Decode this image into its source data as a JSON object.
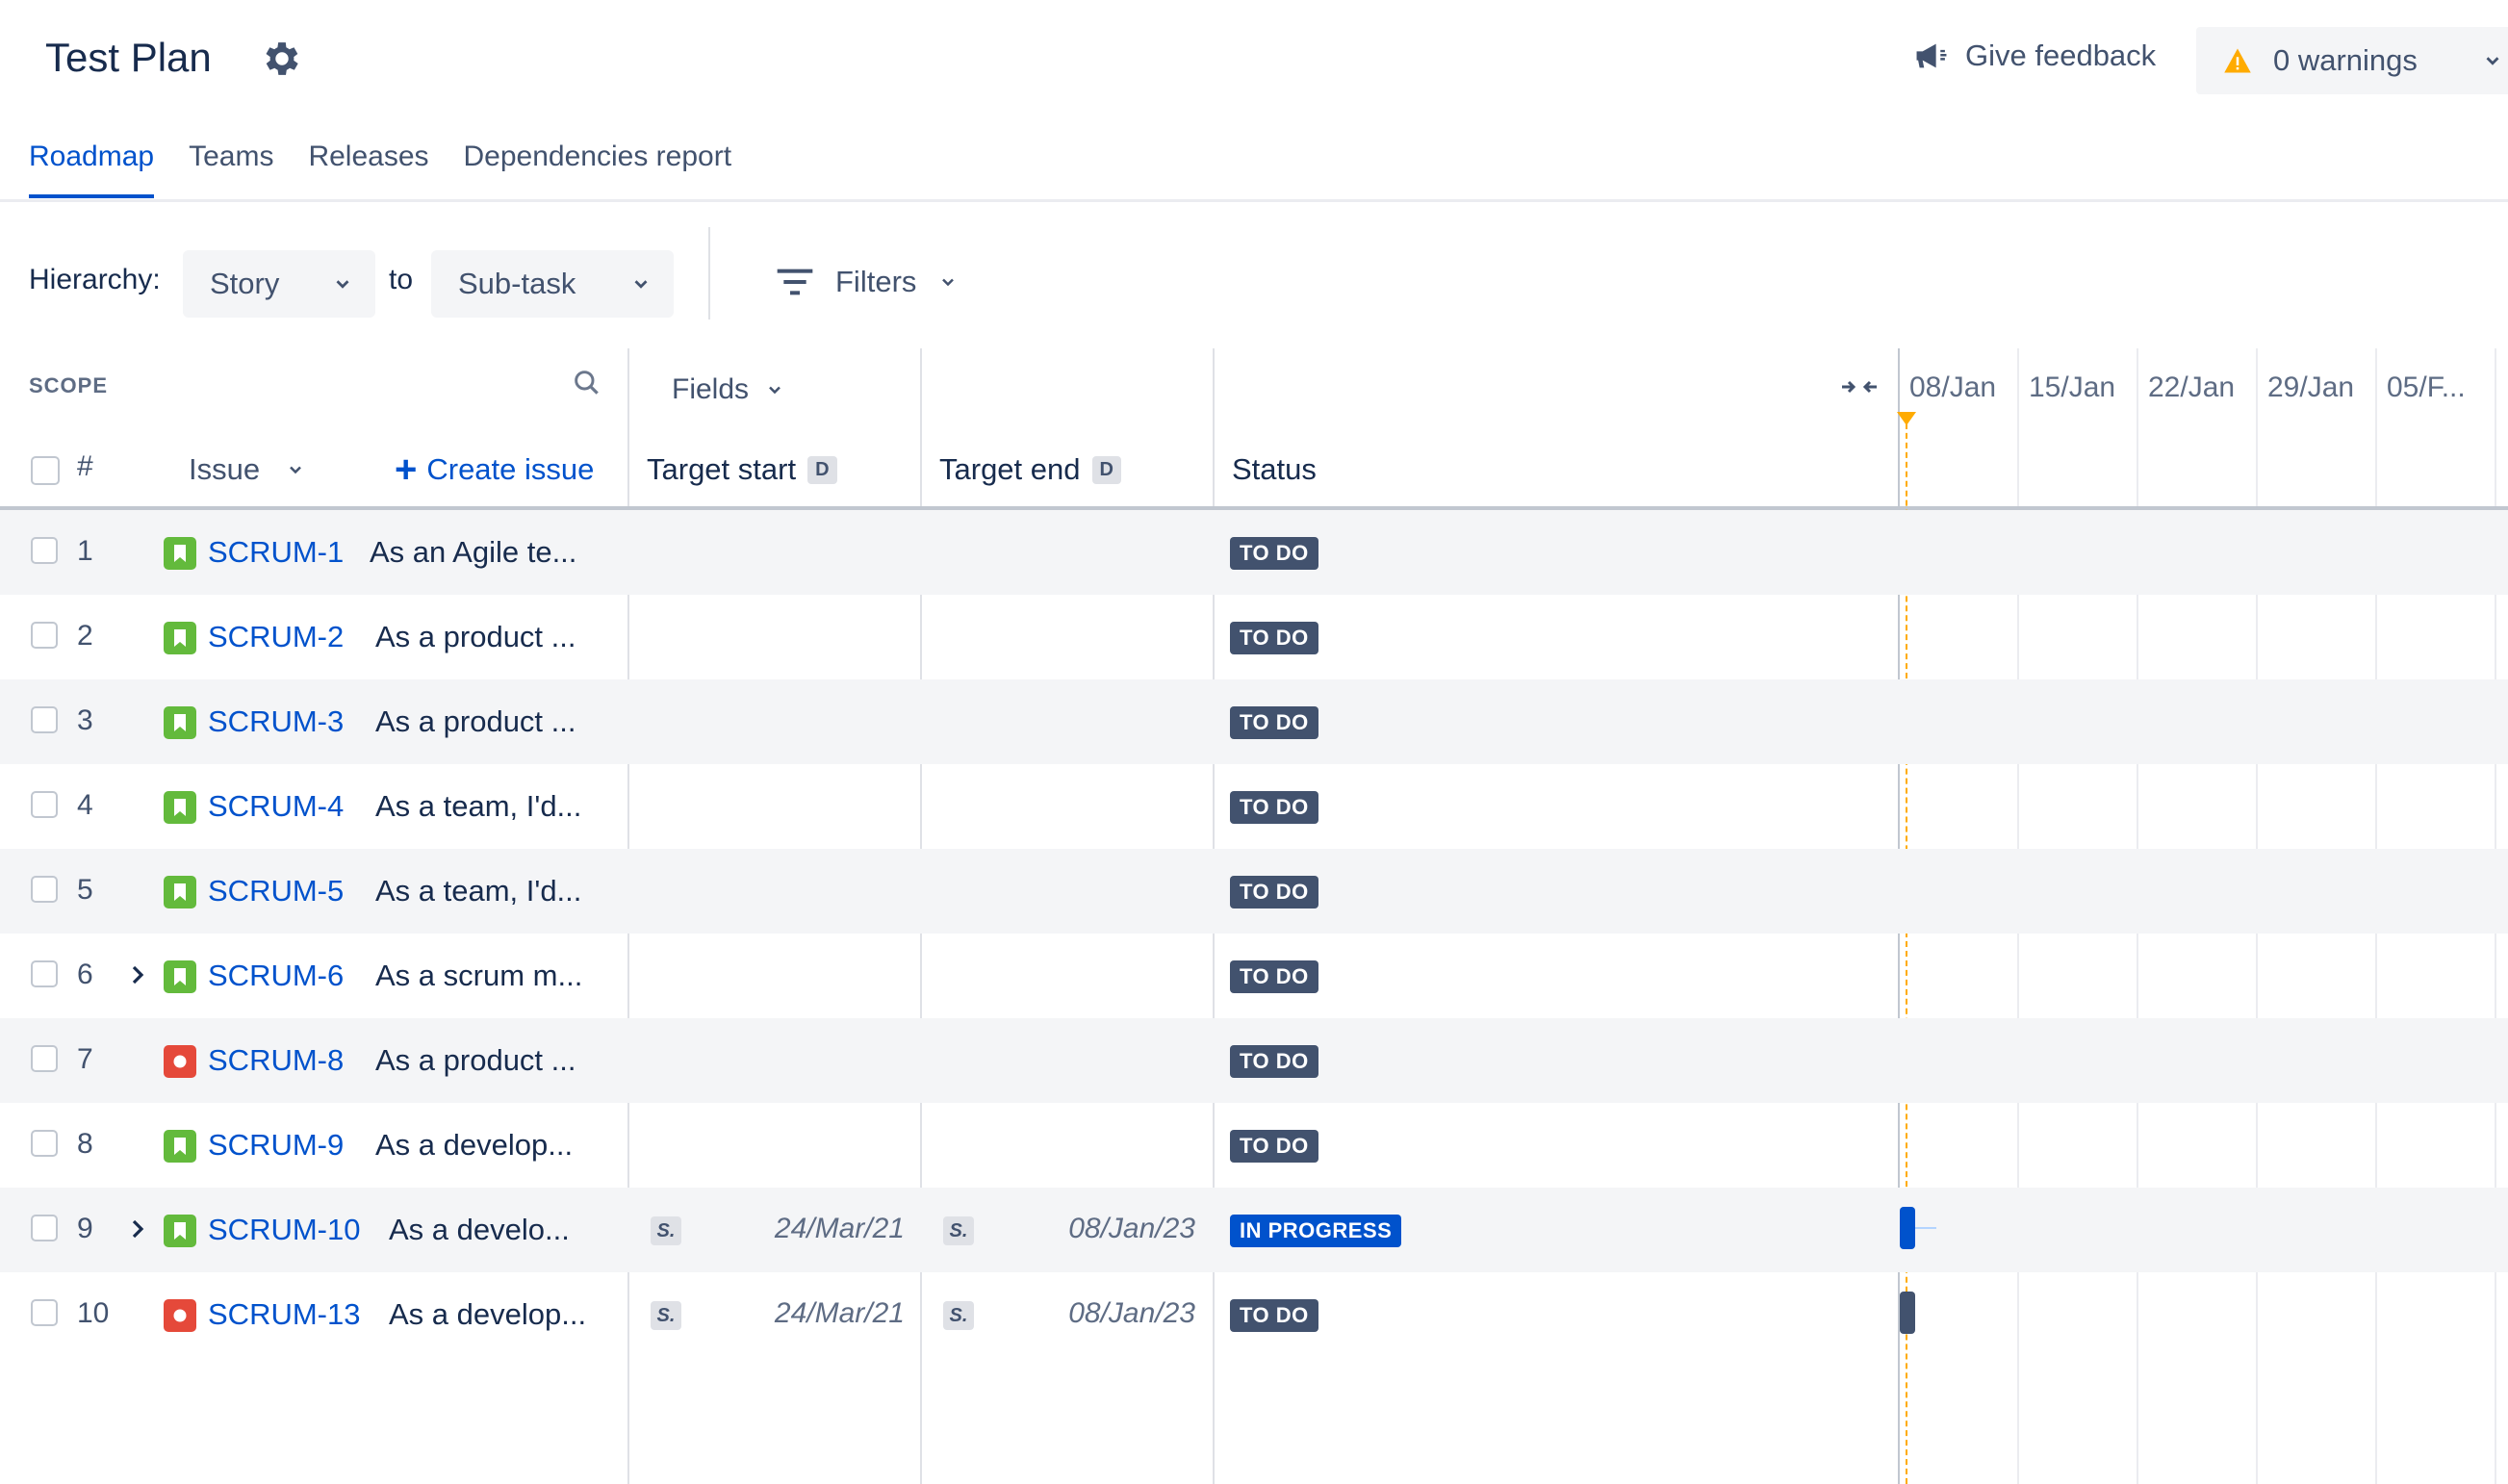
{
  "header": {
    "title": "Test Plan",
    "feedback_label": "Give feedback",
    "warnings_label": "0 warnings"
  },
  "tabs": [
    {
      "label": "Roadmap",
      "active": true
    },
    {
      "label": "Teams",
      "active": false
    },
    {
      "label": "Releases",
      "active": false
    },
    {
      "label": "Dependencies report",
      "active": false
    }
  ],
  "toolbar": {
    "hierarchy_label": "Hierarchy:",
    "hierarchy_from": "Story",
    "to_label": "to",
    "hierarchy_to": "Sub-task",
    "filters_label": "Filters"
  },
  "scope": {
    "label": "SCOPE",
    "hash_label": "#",
    "issue_label": "Issue",
    "create_issue_label": "Create issue"
  },
  "columns": {
    "fields_label": "Fields",
    "target_start": "Target start",
    "target_end": "Target end",
    "date_badge": "D",
    "status": "Status"
  },
  "timeline": {
    "dates": [
      "08/Jan",
      "15/Jan",
      "22/Jan",
      "29/Jan",
      "05/F..."
    ]
  },
  "rows": [
    {
      "num": "1",
      "type": "story",
      "key": "SCRUM-1",
      "summary": "As an Agile te...",
      "expandable": false,
      "start_badge": "",
      "start": "",
      "end_badge": "",
      "end": "",
      "status": "TO DO",
      "status_kind": "todo",
      "bar": ""
    },
    {
      "num": "2",
      "type": "story",
      "key": "SCRUM-2",
      "summary": "As a product ...",
      "expandable": false,
      "start_badge": "",
      "start": "",
      "end_badge": "",
      "end": "",
      "status": "TO DO",
      "status_kind": "todo",
      "bar": ""
    },
    {
      "num": "3",
      "type": "story",
      "key": "SCRUM-3",
      "summary": "As a product ...",
      "expandable": false,
      "start_badge": "",
      "start": "",
      "end_badge": "",
      "end": "",
      "status": "TO DO",
      "status_kind": "todo",
      "bar": ""
    },
    {
      "num": "4",
      "type": "story",
      "key": "SCRUM-4",
      "summary": "As a team, I'd...",
      "expandable": false,
      "start_badge": "",
      "start": "",
      "end_badge": "",
      "end": "",
      "status": "TO DO",
      "status_kind": "todo",
      "bar": ""
    },
    {
      "num": "5",
      "type": "story",
      "key": "SCRUM-5",
      "summary": "As a team, I'd...",
      "expandable": false,
      "start_badge": "",
      "start": "",
      "end_badge": "",
      "end": "",
      "status": "TO DO",
      "status_kind": "todo",
      "bar": ""
    },
    {
      "num": "6",
      "type": "story",
      "key": "SCRUM-6",
      "summary": "As a scrum m...",
      "expandable": true,
      "start_badge": "",
      "start": "",
      "end_badge": "",
      "end": "",
      "status": "TO DO",
      "status_kind": "todo",
      "bar": ""
    },
    {
      "num": "7",
      "type": "bug",
      "key": "SCRUM-8",
      "summary": "As a product ...",
      "expandable": false,
      "start_badge": "",
      "start": "",
      "end_badge": "",
      "end": "",
      "status": "TO DO",
      "status_kind": "todo",
      "bar": ""
    },
    {
      "num": "8",
      "type": "story",
      "key": "SCRUM-9",
      "summary": "As a develop...",
      "expandable": false,
      "start_badge": "",
      "start": "",
      "end_badge": "",
      "end": "",
      "status": "TO DO",
      "status_kind": "todo",
      "bar": ""
    },
    {
      "num": "9",
      "type": "story",
      "key": "SCRUM-10",
      "summary": "As a develo...",
      "expandable": true,
      "start_badge": "S.",
      "start": "24/Mar/21",
      "end_badge": "S.",
      "end": "08/Jan/23",
      "status": "IN PROGRESS",
      "status_kind": "inprog",
      "bar": "blue"
    },
    {
      "num": "10",
      "type": "bug",
      "key": "SCRUM-13",
      "summary": "As a develop...",
      "expandable": false,
      "start_badge": "S.",
      "start": "24/Mar/21",
      "end_badge": "S.",
      "end": "08/Jan/23",
      "status": "TO DO",
      "status_kind": "todo",
      "bar": "dark"
    }
  ],
  "colors": {
    "accent": "#0052cc",
    "todo": "#42526e",
    "story": "#63ba3c",
    "bug": "#e5493a",
    "today": "#ffab00"
  }
}
